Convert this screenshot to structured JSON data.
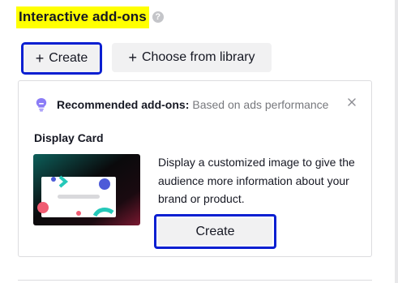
{
  "section": {
    "title": "Interactive add-ons",
    "help_icon": "question-circle-icon",
    "help_glyph": "?"
  },
  "actions": {
    "create_label": "Create",
    "library_label": "Choose from library",
    "plus_glyph": "+"
  },
  "recommendation": {
    "icon": "lightbulb-icon",
    "label": "Recommended add-ons:",
    "subtitle": "Based on ads performance",
    "close_icon": "close-icon"
  },
  "display_card": {
    "title": "Display Card",
    "description": "Display a customized image to give the audience more information about your brand or product.",
    "create_label": "Create"
  },
  "colors": {
    "highlight": "#ffff00",
    "focus_outline": "#0a1fd1",
    "button_bg": "#f1f1f2",
    "accent_purple": "#8b7cf6"
  }
}
